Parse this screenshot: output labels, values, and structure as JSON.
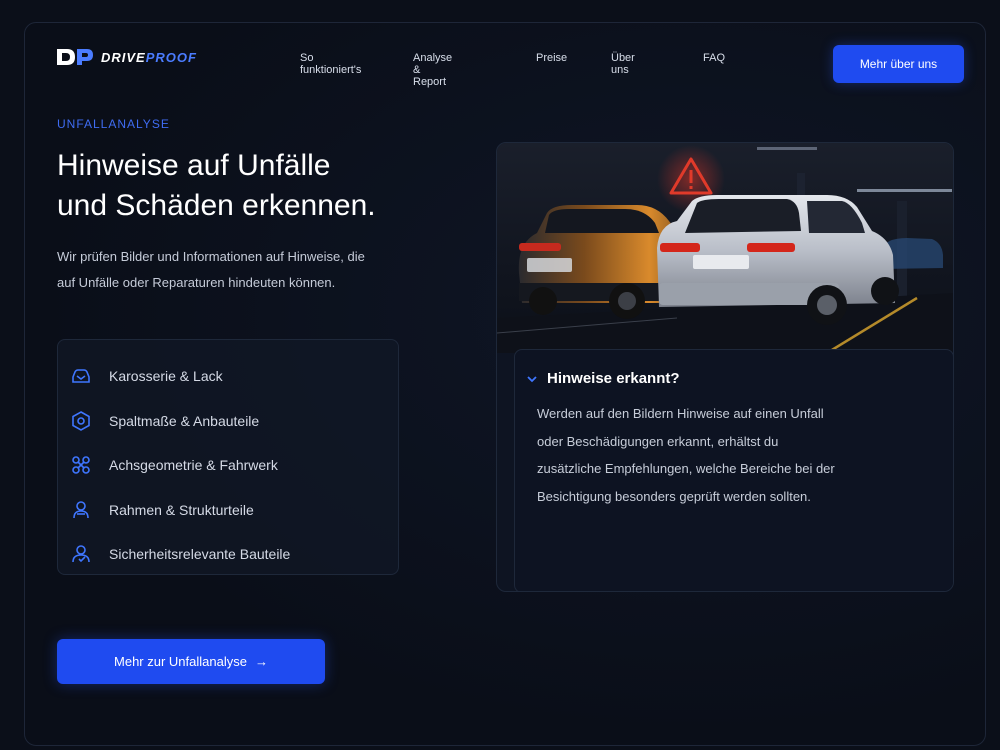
{
  "brand": {
    "name_part1": "DRIVE",
    "name_part2": "PROOF",
    "accent": "#4b7cff"
  },
  "nav": {
    "items": [
      "So funktioniert's",
      "Analyse & Report",
      "Preise",
      "Über uns",
      "FAQ"
    ],
    "cta_label": "Mehr über uns"
  },
  "hero": {
    "eyebrow": "UNFALLANALYSE",
    "headline_line1": "Hinweise auf Unfälle",
    "headline_line2": "und Schäden erkennen.",
    "lead": "Wir prüfen Bilder und Informationen auf Hinweise, die auf Unfälle oder Reparaturen hindeuten können."
  },
  "features": [
    {
      "label": "Karosserie & Lack",
      "icon": "car-body-icon"
    },
    {
      "label": "Spaltmaße & Anbauteile",
      "icon": "gap-gauge-icon"
    },
    {
      "label": "Achsgeometrie & Fahrwerk",
      "icon": "axle-icon"
    },
    {
      "label": "Rahmen & Strukturteile",
      "icon": "frame-icon"
    },
    {
      "label": "Sicherheitsrelevante Bauteile",
      "icon": "safety-icon"
    }
  ],
  "cta": {
    "label": "Mehr zur Unfallanalyse",
    "arrow": "→"
  },
  "card": {
    "image_icon": "warning-triangle-icon",
    "title": "Hinweise erkannt?",
    "body": "Werden auf den Bildern Hinweise auf einen Unfall oder Beschädigungen erkannt, erhältst du zusätzliche Empfehlungen, welche Bereiche bei der Besichtigung besonders geprüft werden sollten."
  },
  "colors": {
    "background": "#0b0f19",
    "primary": "#1f4bf0",
    "warning": "#e03a2a"
  }
}
